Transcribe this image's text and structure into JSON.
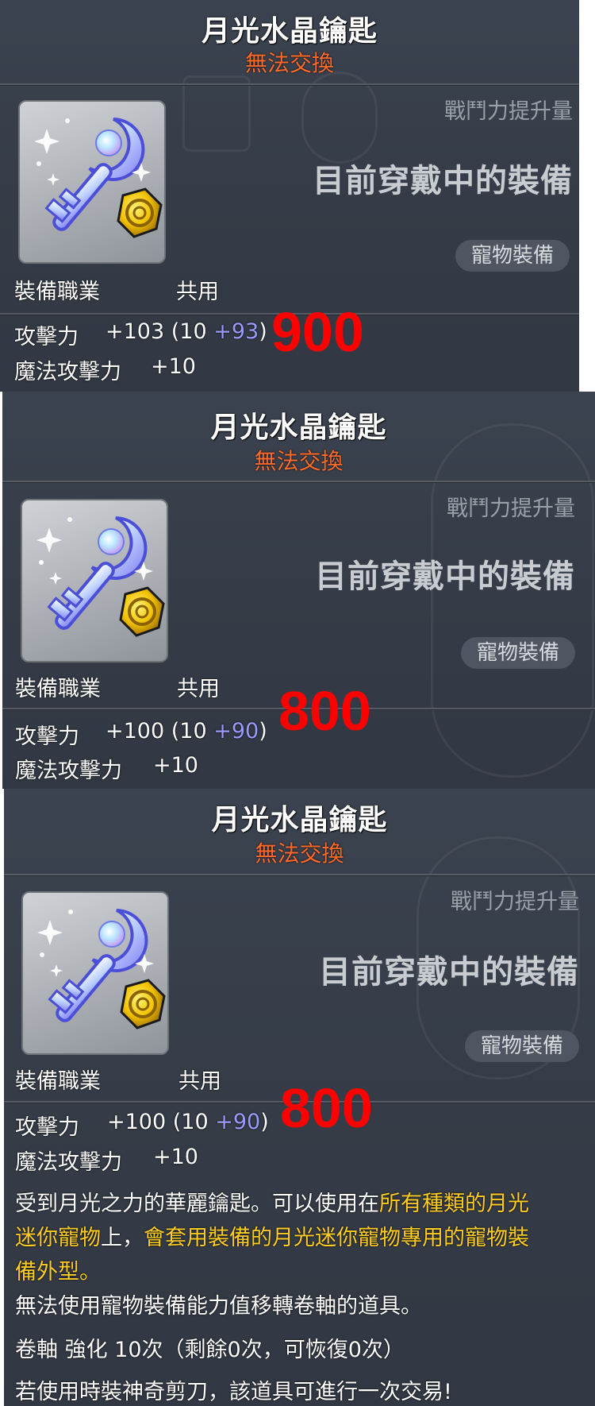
{
  "colors": {
    "panel_bg": "#353c47",
    "title": "#ffffff",
    "untradeable": "#ff6a2b",
    "bonus_stat": "#9b9bff",
    "highlight_text": "#ffcc22",
    "overlay_number": "#ff0000"
  },
  "panels": [
    {
      "title": "月光水晶鑰匙",
      "trade_status": "無法交換",
      "icon": "moonlight-crystal-key-icon",
      "cp_label": "戰鬥力提升量",
      "equipped_label": "目前穿戴中的裝備",
      "pet_equip_badge": "寵物裝備",
      "job_label": "裝備職業",
      "job_value": "共用",
      "attack_label": "攻擊力",
      "attack_total": "+103",
      "attack_base": "(10",
      "attack_bonus": "+93",
      "attack_close": ")",
      "magic_label": "魔法攻擊力",
      "magic_value": "+10",
      "overlay_number": "900"
    },
    {
      "title": "月光水晶鑰匙",
      "trade_status": "無法交換",
      "icon": "moonlight-crystal-key-icon",
      "cp_label": "戰鬥力提升量",
      "equipped_label": "目前穿戴中的裝備",
      "pet_equip_badge": "寵物裝備",
      "job_label": "裝備職業",
      "job_value": "共用",
      "attack_label": "攻擊力",
      "attack_total": "+100",
      "attack_base": "(10",
      "attack_bonus": "+90",
      "attack_close": ")",
      "magic_label": "魔法攻擊力",
      "magic_value": "+10",
      "overlay_number": "800"
    },
    {
      "title": "月光水晶鑰匙",
      "trade_status": "無法交換",
      "icon": "moonlight-crystal-key-icon",
      "cp_label": "戰鬥力提升量",
      "equipped_label": "目前穿戴中的裝備",
      "pet_equip_badge": "寵物裝備",
      "job_label": "裝備職業",
      "job_value": "共用",
      "attack_label": "攻擊力",
      "attack_total": "+100",
      "attack_base": "(10",
      "attack_bonus": "+90",
      "attack_close": ")",
      "magic_label": "魔法攻擊力",
      "magic_value": "+10",
      "overlay_number": "800",
      "description": {
        "line1_a": "受到月光之力的華麗鑰匙。可以使用在",
        "line1_b": "所有種類的月光",
        "line2_a": "迷你寵物",
        "line2_b": "上，",
        "line2_c": "會套用裝備的月光迷你寵物專用的寵物裝",
        "line3": "備外型。",
        "line4": "無法使用寵物裝備能力值移轉卷軸的道具。",
        "line5": "卷軸 強化 10次（剩餘0次，可恢復0次）",
        "line6": "若使用時裝神奇剪刀，該道具可進行一次交易!"
      }
    }
  ]
}
